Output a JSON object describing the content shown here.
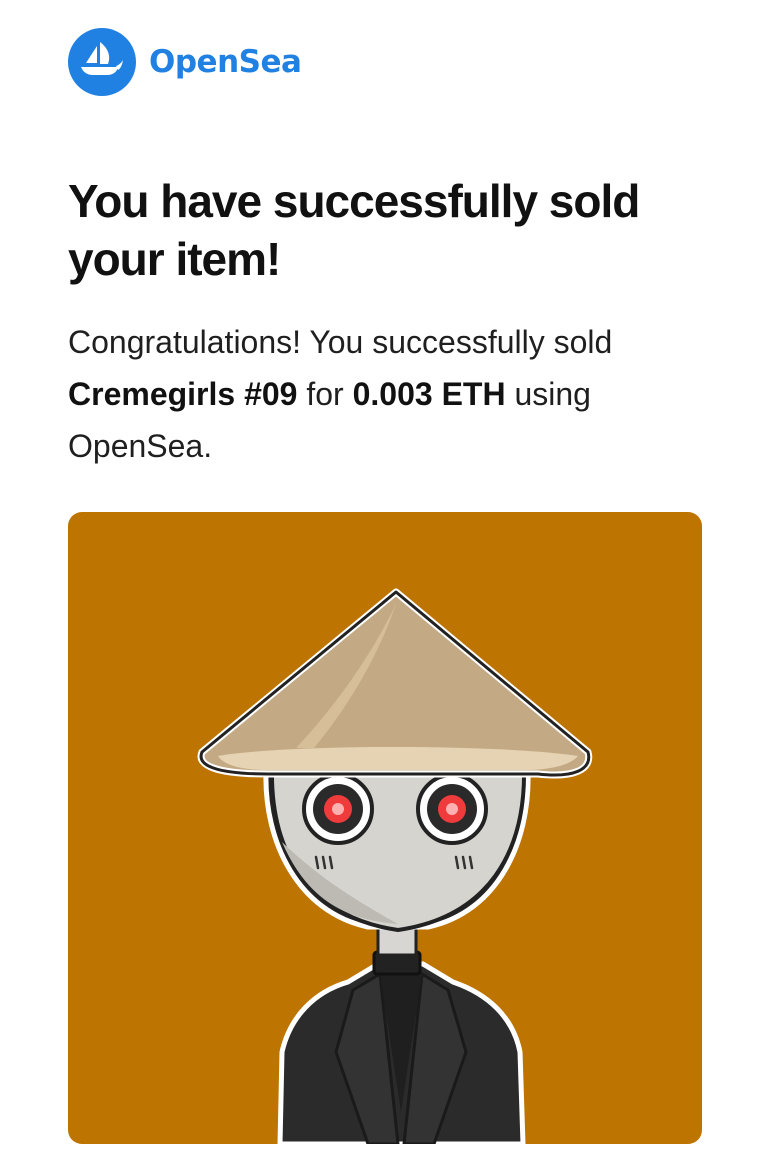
{
  "brand": {
    "name": "OpenSea",
    "logo_icon": "sailboat-icon",
    "color": "#2081E2"
  },
  "title": "You have successfully sold your item!",
  "message": {
    "prefix": "Congratulations! You successfully sold",
    "item_name": "Cremegirls #09",
    "connector": "for",
    "price": "0.003 ETH",
    "suffix": "using OpenSea."
  },
  "nft_image": {
    "background_color": "#BD7400",
    "subject": "robot-figure-image"
  }
}
